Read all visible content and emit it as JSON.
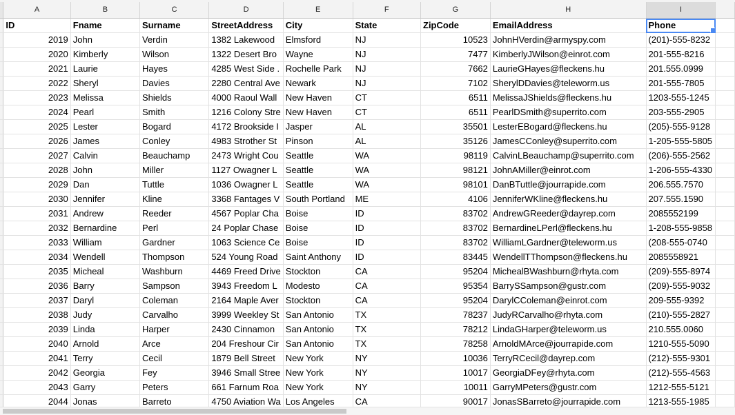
{
  "columns": [
    "A",
    "B",
    "C",
    "D",
    "E",
    "F",
    "G",
    "H",
    "I",
    ""
  ],
  "selected_column": "I",
  "selected_cell": "I1",
  "headers": [
    "ID",
    "Fname",
    "Surname",
    "StreetAddress",
    "City",
    "State",
    "ZipCode",
    "EmailAddress",
    "Phone"
  ],
  "rows": [
    [
      "2019",
      "John",
      "Verdin",
      "1382 Lakewood",
      "Elmsford",
      "NJ",
      "10523",
      "JohnHVerdin@armyspy.com",
      "(201)-555-8232"
    ],
    [
      "2020",
      "Kimberly",
      "Wilson",
      "1322 Desert Bro",
      "Wayne",
      "NJ",
      "7477",
      "KimberlyJWilson@einrot.com",
      "201-555-8216"
    ],
    [
      "2021",
      "Laurie",
      "Hayes",
      "4285 West Side .",
      "Rochelle Park",
      "NJ",
      "7662",
      "LaurieGHayes@fleckens.hu",
      "201.555.0999"
    ],
    [
      "2022",
      "Sheryl",
      "Davies",
      "2280 Central Ave",
      "Newark",
      "NJ",
      "7102",
      "SherylDDavies@teleworm.us",
      "201-555-7805"
    ],
    [
      "2023",
      "Melissa",
      "Shields",
      "4000 Raoul Wall",
      "New Haven",
      "CT",
      "6511",
      "MelissaJShields@fleckens.hu",
      "1203-555-1245"
    ],
    [
      "2024",
      "Pearl",
      "Smith",
      "1216 Colony Stre",
      "New Haven",
      "CT",
      "6511",
      "PearlDSmith@superrito.com",
      "203-555-2905"
    ],
    [
      "2025",
      "Lester",
      "Bogard",
      "4172 Brookside I",
      "Jasper",
      "AL",
      "35501",
      "LesterEBogard@fleckens.hu",
      "(205)-555-9128"
    ],
    [
      "2026",
      "James",
      "Conley",
      "4983 Strother St",
      "Pinson",
      "AL",
      "35126",
      "JamesCConley@superrito.com",
      "1-205-555-5805"
    ],
    [
      "2027",
      "Calvin",
      "Beauchamp",
      "2473 Wright Cou",
      "Seattle",
      "WA",
      "98119",
      "CalvinLBeauchamp@superrito.com",
      "(206)-555-2562"
    ],
    [
      "2028",
      "John",
      "Miller",
      "1127 Owagner L",
      "Seattle",
      "WA",
      "98121",
      "JohnAMiller@einrot.com",
      "1-206-555-4330"
    ],
    [
      "2029",
      "Dan",
      "Tuttle",
      "1036 Owagner L",
      "Seattle",
      "WA",
      "98101",
      "DanBTuttle@jourrapide.com",
      "206.555.7570"
    ],
    [
      "2030",
      "Jennifer",
      "Kline",
      "3368 Fantages V",
      "South Portland",
      "ME",
      "4106",
      "JenniferWKline@fleckens.hu",
      "207.555.1590"
    ],
    [
      "2031",
      "Andrew",
      "Reeder",
      "4567 Poplar Cha",
      "Boise",
      "ID",
      "83702",
      "AndrewGReeder@dayrep.com",
      "2085552199"
    ],
    [
      "2032",
      "Bernardine",
      "Perl",
      "24 Poplar Chase",
      "Boise",
      "ID",
      "83702",
      "BernardineLPerl@fleckens.hu",
      "1-208-555-9858"
    ],
    [
      "2033",
      "William",
      "Gardner",
      "1063 Science Ce",
      "Boise",
      "ID",
      "83702",
      "WilliamLGardner@teleworm.us",
      "(208-555-0740"
    ],
    [
      "2034",
      "Wendell",
      "Thompson",
      "524 Young Road",
      "Saint Anthony",
      "ID",
      "83445",
      "WendellTThompson@fleckens.hu",
      "2085558921"
    ],
    [
      "2035",
      "Micheal",
      "Washburn",
      "4469 Freed Drive",
      "Stockton",
      "CA",
      "95204",
      "MichealBWashburn@rhyta.com",
      "(209)-555-8974"
    ],
    [
      "2036",
      "Barry",
      "Sampson",
      "3943 Freedom L",
      "Modesto",
      "CA",
      "95354",
      "BarrySSampson@gustr.com",
      "(209)-555-9032"
    ],
    [
      "2037",
      "Daryl",
      "Coleman",
      "2164 Maple Aver",
      "Stockton",
      "CA",
      "95204",
      "DarylCColeman@einrot.com",
      "209-555-9392"
    ],
    [
      "2038",
      "Judy",
      "Carvalho",
      "3999 Weekley St",
      "San Antonio",
      "TX",
      "78237",
      "JudyRCarvalho@rhyta.com",
      "(210)-555-2827"
    ],
    [
      "2039",
      "Linda",
      "Harper",
      "2430 Cinnamon",
      "San Antonio",
      "TX",
      "78212",
      "LindaGHarper@teleworm.us",
      "210.555.0060"
    ],
    [
      "2040",
      "Arnold",
      "Arce",
      "204 Freshour Cir",
      "San Antonio",
      "TX",
      "78258",
      "ArnoldMArce@jourrapide.com",
      "1210-555-5090"
    ],
    [
      "2041",
      "Terry",
      "Cecil",
      "1879 Bell Street",
      "New York",
      "NY",
      "10036",
      "TerryRCecil@dayrep.com",
      "(212)-555-9301"
    ],
    [
      "2042",
      "Georgia",
      "Fey",
      "3946 Small Stree",
      "New York",
      "NY",
      "10017",
      "GeorgiaDFey@rhyta.com",
      "(212)-555-4563"
    ],
    [
      "2043",
      "Garry",
      "Peters",
      "661 Farnum Roa",
      "New York",
      "NY",
      "10011",
      "GarryMPeters@gustr.com",
      "1212-555-5121"
    ],
    [
      "2044",
      "Jonas",
      "Barreto",
      "4750 Aviation Wa",
      "Los Angeles",
      "CA",
      "90017",
      "JonasSBarreto@jourrapide.com",
      "1213-555-1985"
    ]
  ],
  "numeric_columns": [
    0,
    6
  ]
}
